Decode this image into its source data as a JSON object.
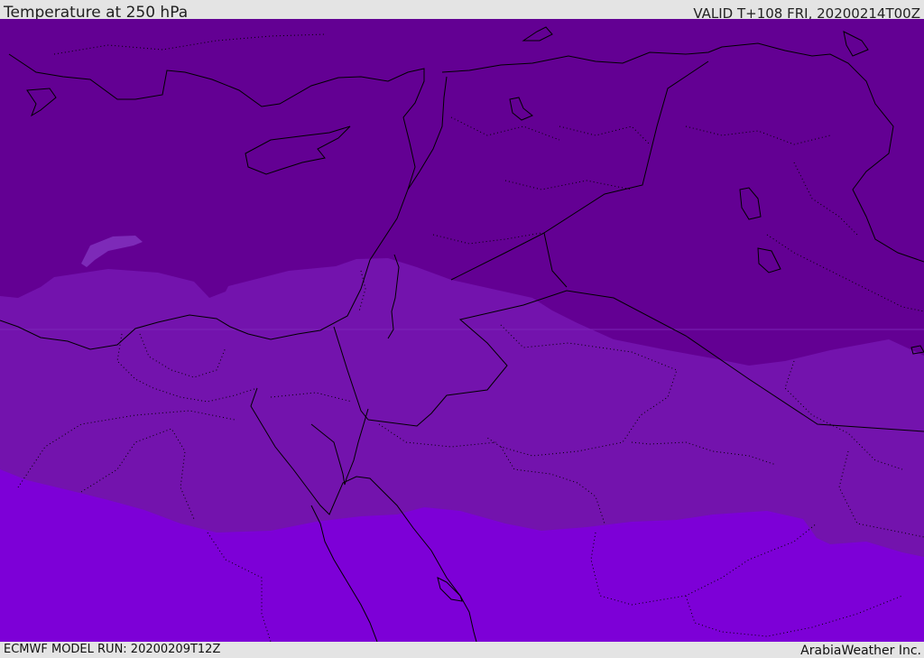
{
  "header": {
    "title": "Temperature at 250 hPa",
    "valid": "VALID T+108 FRI, 20200214T00Z"
  },
  "footer": {
    "model_run": "ECMWF MODEL RUN: 20200209T12Z",
    "credit": "ArabiaWeather Inc."
  },
  "colors": {
    "band_cold": "#630093",
    "band_mid": "#7313ad",
    "band_warm": "#7d00d7",
    "band_patch": "#7d2ab8",
    "coastline": "#000000",
    "background": "#e4e4e4"
  }
}
